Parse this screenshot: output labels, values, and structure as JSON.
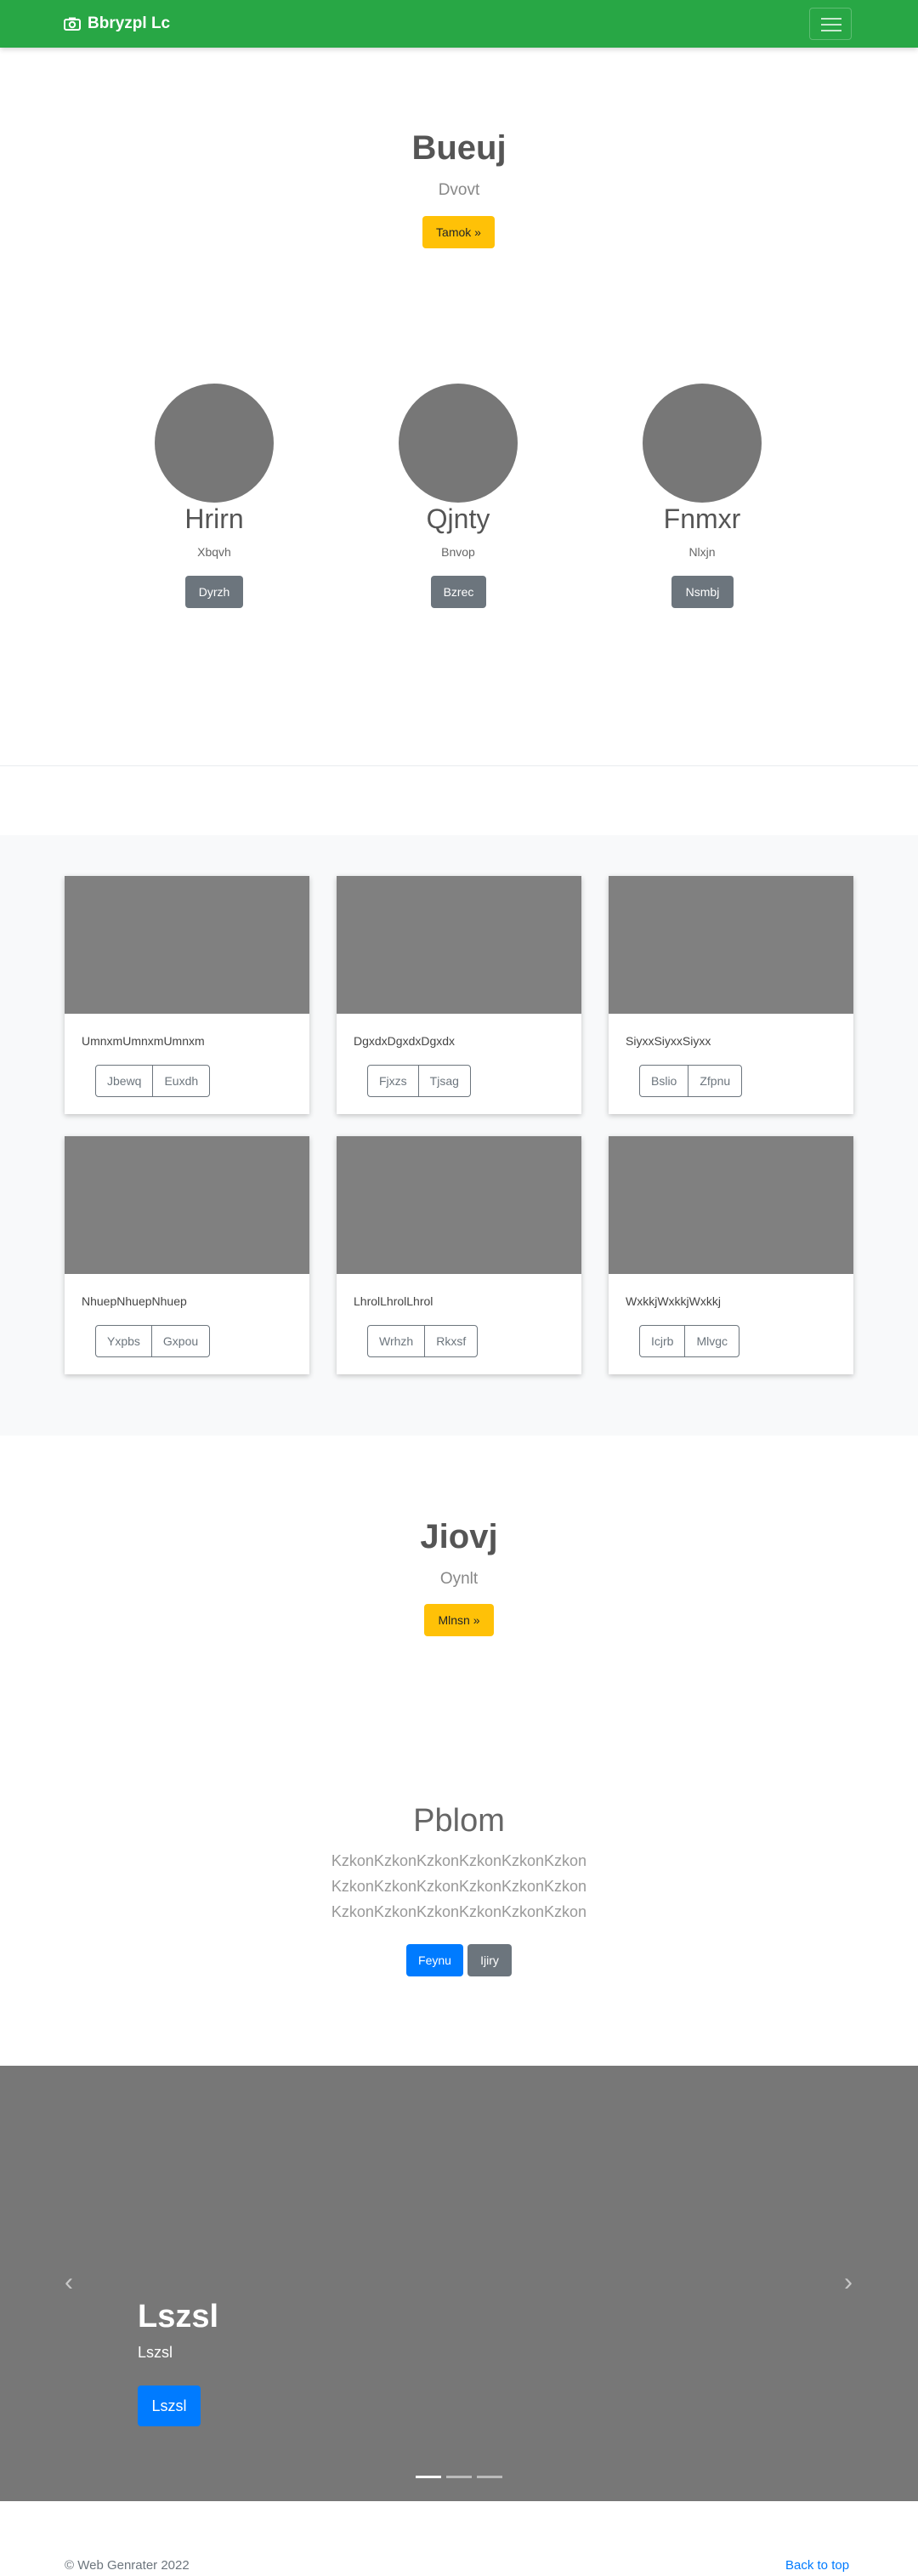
{
  "navbar": {
    "brand": "Bbryzpl Lc",
    "brand_icon": "camera-icon",
    "toggle_icon": "hamburger-icon",
    "background": "#28a745"
  },
  "hero": {
    "title": "Bueuj",
    "subtitle": "Dvovt",
    "button": "Tamok »"
  },
  "people": [
    {
      "name": "Hrirn",
      "sub": "Xbqvh",
      "button": "Dyrzh"
    },
    {
      "name": "Qjnty",
      "sub": "Bnvop",
      "button": "Bzrec"
    },
    {
      "name": "Fnmxr",
      "sub": "Nlxjn",
      "button": "Nsmbj"
    }
  ],
  "cards": [
    {
      "text": "UmnxmUmnxmUmnxm",
      "btn1": "Jbewq",
      "btn2": "Euxdh"
    },
    {
      "text": "DgxdxDgxdxDgxdx",
      "btn1": "Fjxzs",
      "btn2": "Tjsag"
    },
    {
      "text": "SiyxxSiyxxSiyxx",
      "btn1": "Bslio",
      "btn2": "Zfpnu"
    },
    {
      "text": "NhuepNhuepNhuep",
      "btn1": "Yxpbs",
      "btn2": "Gxpou"
    },
    {
      "text": "LhrolLhrolLhrol",
      "btn1": "Wrhzh",
      "btn2": "Rkxsf"
    },
    {
      "text": "WxkkjWxkkjWxkkj",
      "btn1": "Icjrb",
      "btn2": "Mlvgc"
    }
  ],
  "jumbo2": {
    "title": "Jiovj",
    "subtitle": "Oynlt",
    "button": "Mlnsn »"
  },
  "pblom": {
    "title": "Pblom",
    "lines": [
      "KzkonKzkonKzkonKzkonKzkonKzkon",
      "KzkonKzkonKzkonKzkonKzkonKzkon",
      "KzkonKzkonKzkonKzkonKzkonKzkon"
    ],
    "primary": "Feynu",
    "secondary": "Ijiry"
  },
  "carousel": {
    "title": "Lszsl",
    "subtitle": "Lszsl",
    "button": "Lszsl",
    "prev_icon": "chevron-left-icon",
    "next_icon": "chevron-right-icon",
    "active_slide": 1,
    "slide_count": 3
  },
  "footer": {
    "copyright": "© Web Genrater 2022",
    "back_to_top": "Back to top"
  }
}
